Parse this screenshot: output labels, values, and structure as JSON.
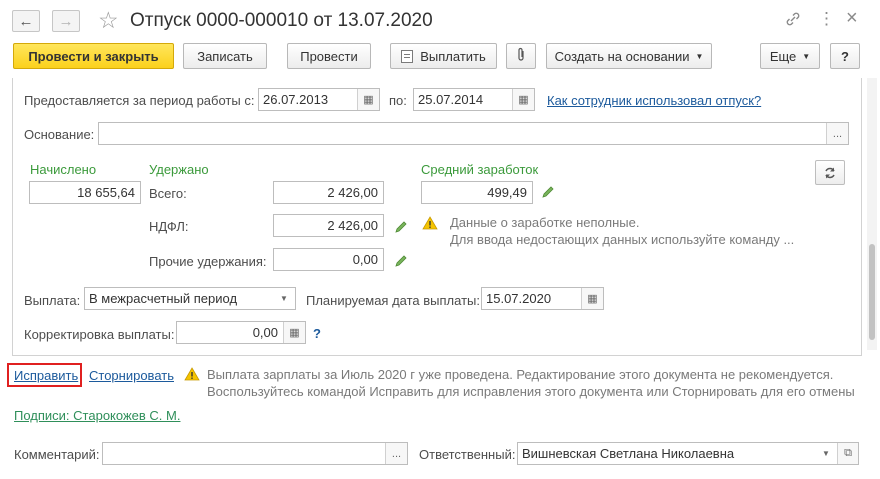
{
  "window": {
    "title": "Отпуск 0000-000010 от 13.07.2020",
    "star_icon": "star-icon",
    "link_icon": "link-icon",
    "menu_icon": "more-vertical-icon",
    "close_icon": "close-icon"
  },
  "toolbar": {
    "post_close": "Провести и закрыть",
    "save": "Записать",
    "post": "Провести",
    "pay": "Выплатить",
    "attach_icon": "paperclip-icon",
    "create_based": "Создать на основании",
    "more": "Еще",
    "help": "?"
  },
  "period": {
    "label": "Предоставляется за период работы с:",
    "from": "26.07.2013",
    "to_label": "по:",
    "to": "25.07.2014",
    "link": "Как сотрудник использовал отпуск?"
  },
  "basis": {
    "label": "Основание:",
    "value": "",
    "button": "..."
  },
  "accrued": {
    "label": "Начислено",
    "value": "18 655,64"
  },
  "withheld": {
    "label": "Удержано",
    "total_label": "Всего:",
    "total": "2 426,00",
    "ndfl_label": "НДФЛ:",
    "ndfl": "2 426,00",
    "other_label": "Прочие удержания:",
    "other": "0,00"
  },
  "avg": {
    "label": "Средний заработок",
    "value": "499,49",
    "warn_line1": "Данные о заработке неполные.",
    "warn_line2": "Для ввода недостающих данных используйте команду ..."
  },
  "payment": {
    "label": "Выплата:",
    "value": "В межрасчетный период",
    "planned_label": "Планируемая дата выплаты:",
    "planned": "15.07.2020"
  },
  "correction": {
    "label": "Корректировка выплаты:",
    "value": "0,00",
    "help": "?"
  },
  "actions": {
    "fix": "Исправить",
    "storno": "Сторнировать",
    "warn_line1": "Выплата зарплаты за Июль 2020 г уже проведена. Редактирование этого документа не рекомендуется.",
    "warn_line2": "Воспользуйтесь командой Исправить для исправления этого документа или Сторнировать для его отмены"
  },
  "signatures": {
    "link": "Подписи: Старокожев С. М."
  },
  "footer": {
    "comment_label": "Комментарий:",
    "comment": "",
    "comment_button": "...",
    "responsible_label": "Ответственный:",
    "responsible": "Вишневская Светлана Николаевна"
  },
  "colors": {
    "accent_yellow": "#fbd11c",
    "green": "#3b9a3b",
    "link": "#1c5a9c",
    "highlight": "#e02020"
  }
}
